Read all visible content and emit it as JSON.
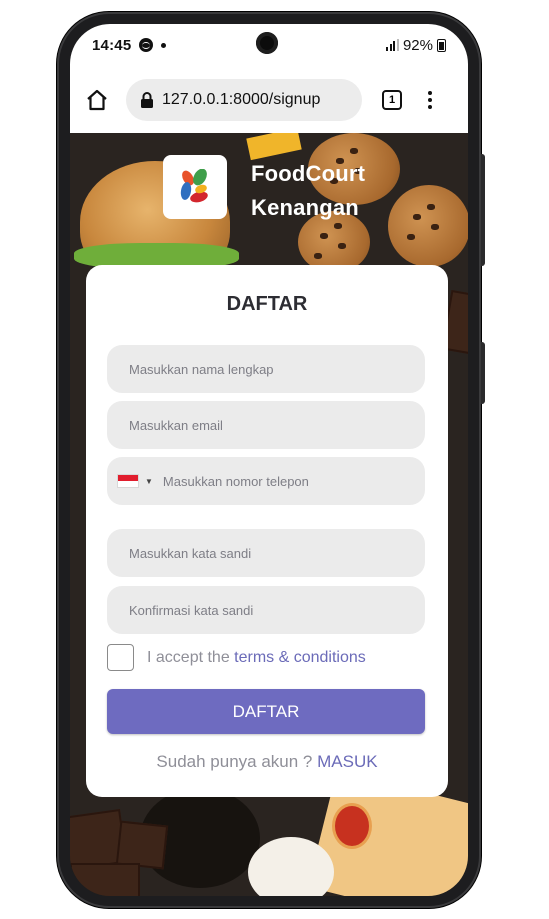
{
  "statusbar": {
    "time": "14:45",
    "battery": "92%"
  },
  "browser": {
    "url": "127.0.0.1:8000/signup",
    "tab_count": "1"
  },
  "brand": {
    "line1": "FoodCourt",
    "line2": "Kenangan"
  },
  "form": {
    "title": "DAFTAR",
    "name_placeholder": "Masukkan nama lengkap",
    "email_placeholder": "Masukkan email",
    "phone_placeholder": "Masukkan nomor telepon",
    "password_placeholder": "Masukkan kata sandi",
    "confirm_placeholder": "Konfirmasi kata sandi",
    "accept_prefix": "I accept the ",
    "accept_link": "terms & conditions",
    "submit_label": "DAFTAR",
    "login_prompt": "Sudah punya akun ? ",
    "login_link": "MASUK"
  },
  "colors": {
    "accent": "#6e6bc0",
    "link": "#6b6bb8",
    "field_bg": "#ebebeb"
  }
}
